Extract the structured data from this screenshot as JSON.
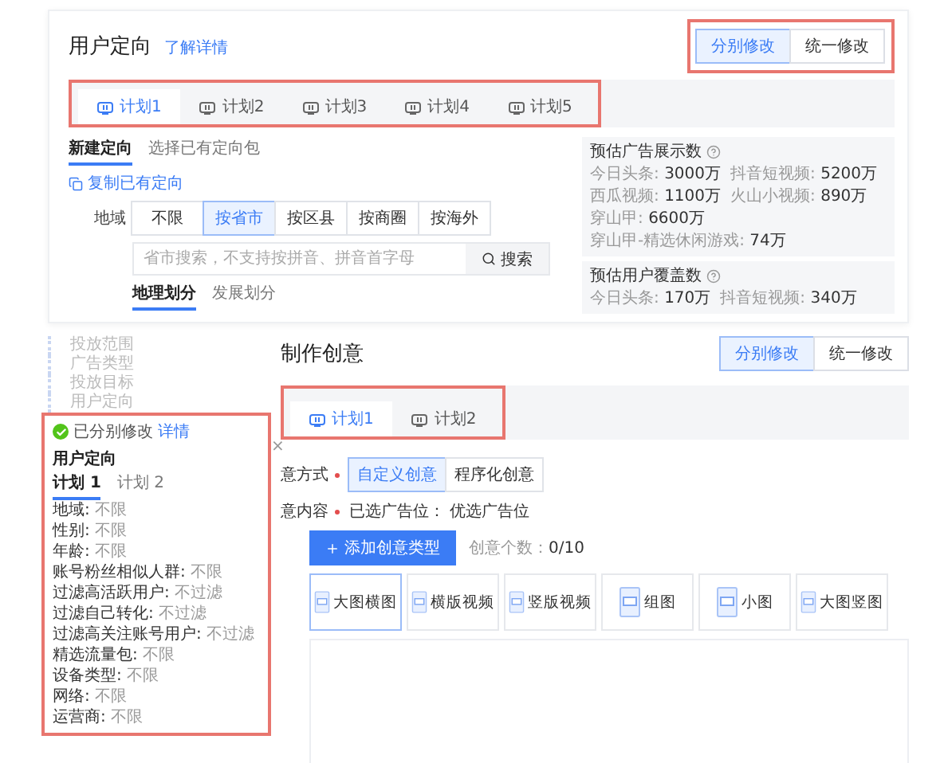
{
  "top": {
    "title": "用户定向",
    "link": "了解详情",
    "modes": [
      {
        "label": "分别修改",
        "selected": true
      },
      {
        "label": "统一修改",
        "selected": false
      }
    ],
    "plans": [
      {
        "label": "计划1",
        "selected": true
      },
      {
        "label": "计划2",
        "selected": false
      },
      {
        "label": "计划3",
        "selected": false
      },
      {
        "label": "计划4",
        "selected": false
      },
      {
        "label": "计划5",
        "selected": false
      }
    ],
    "subtabs": [
      {
        "label": "新建定向",
        "selected": true
      },
      {
        "label": "选择已有定向包",
        "selected": false
      }
    ],
    "copy_link": "复制已有定向",
    "region": {
      "label": "地域",
      "options": [
        {
          "label": "不限",
          "selected": false
        },
        {
          "label": "按省市",
          "selected": true
        },
        {
          "label": "按区县",
          "selected": false
        },
        {
          "label": "按商圈",
          "selected": false
        },
        {
          "label": "按海外",
          "selected": false
        }
      ]
    },
    "search": {
      "placeholder": "省市搜索，不支持按拼音、拼音首字母",
      "button": "搜索"
    },
    "division_tabs": [
      {
        "label": "地理划分",
        "selected": true
      },
      {
        "label": "发展划分",
        "selected": false
      }
    ],
    "estimates": [
      {
        "title": "预估广告展示数",
        "stats": [
          {
            "name": "今日头条:",
            "value": "3000万"
          },
          {
            "name": "抖音短视频:",
            "value": "5200万"
          },
          {
            "name": "西瓜视频:",
            "value": "1100万"
          },
          {
            "name": "火山小视频:",
            "value": "890万"
          },
          {
            "name": "穿山甲:",
            "value": "6600万"
          },
          {
            "name": "穿山甲-精选休闲游戏:",
            "value": "74万"
          }
        ]
      },
      {
        "title": "预估用户覆盖数",
        "stats": [
          {
            "name": "今日头条:",
            "value": "170万"
          },
          {
            "name": "抖音短视频:",
            "value": "340万"
          }
        ]
      }
    ]
  },
  "bottom": {
    "nav": [
      "投放范围",
      "广告类型",
      "投放目标",
      "用户定向"
    ],
    "status": {
      "label": "已分别修改",
      "link": "详情"
    },
    "popup": {
      "title": "用户定向",
      "close": "×",
      "tabs": [
        {
          "label": "计划 1",
          "selected": true
        },
        {
          "label": "计划 2",
          "selected": false
        }
      ],
      "rows": [
        {
          "name": "地域:",
          "value": "不限"
        },
        {
          "name": "性别:",
          "value": "不限"
        },
        {
          "name": "年龄:",
          "value": "不限"
        },
        {
          "name": "账号粉丝相似人群:",
          "value": "不限"
        },
        {
          "name": "过滤高活跃用户:",
          "value": "不过滤"
        },
        {
          "name": "过滤自己转化:",
          "value": "不过滤"
        },
        {
          "name": "过滤高关注账号用户:",
          "value": "不过滤"
        },
        {
          "name": "精选流量包:",
          "value": "不限"
        },
        {
          "name": "设备类型:",
          "value": "不限"
        },
        {
          "name": "网络:",
          "value": "不限"
        },
        {
          "name": "运营商:",
          "value": "不限"
        }
      ]
    },
    "title": "制作创意",
    "modes": [
      {
        "label": "分别修改",
        "selected": true
      },
      {
        "label": "统一修改",
        "selected": false
      }
    ],
    "plans": [
      {
        "label": "计划1",
        "selected": true
      },
      {
        "label": "计划2",
        "selected": false
      }
    ],
    "method": {
      "label": "意方式",
      "options": [
        {
          "label": "自定义创意",
          "selected": true
        },
        {
          "label": "程序化创意",
          "selected": false
        }
      ]
    },
    "content": {
      "label": "意内容",
      "value": "已选广告位： 优选广告位"
    },
    "add_button": "添加创意类型",
    "count": {
      "label": "创意个数：",
      "value": "0/10"
    },
    "formats": [
      {
        "label": "大图横图",
        "selected": true
      },
      {
        "label": "横版视频",
        "selected": false
      },
      {
        "label": "竖版视频",
        "selected": false
      },
      {
        "label": "组图",
        "selected": false
      },
      {
        "label": "小图",
        "selected": false
      },
      {
        "label": "大图竖图",
        "selected": false
      }
    ]
  }
}
